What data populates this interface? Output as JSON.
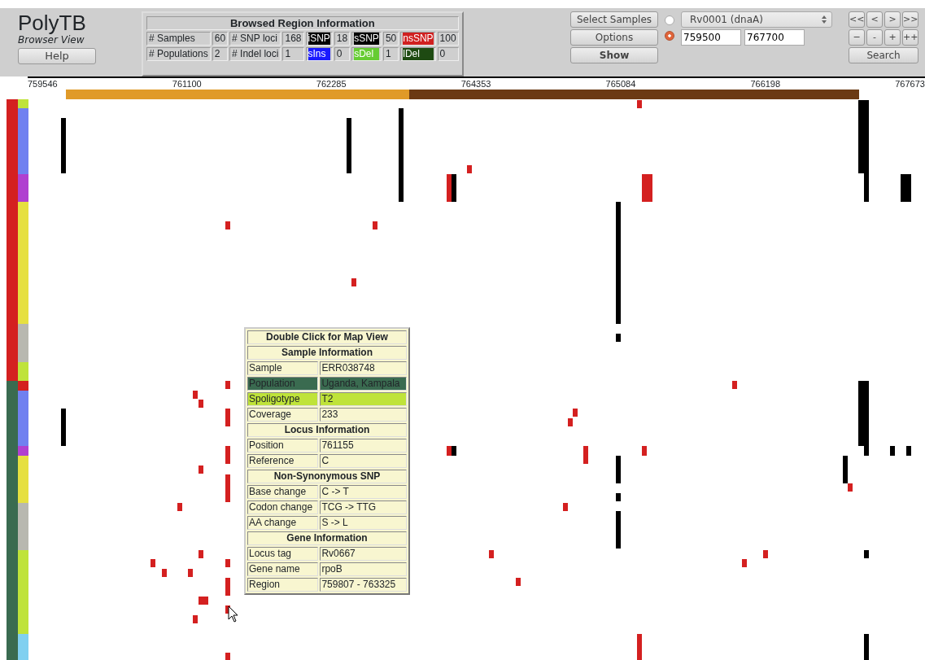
{
  "app": {
    "title": "PolyTB",
    "subtitle": "Browser View",
    "help_button": "Help"
  },
  "region_info": {
    "title": "Browsed Region Information",
    "rows": [
      [
        {
          "kind": "label",
          "text": "# Samples"
        },
        {
          "kind": "value",
          "text": "60"
        },
        {
          "kind": "label",
          "text": "# SNP loci"
        },
        {
          "kind": "value",
          "text": "168"
        },
        {
          "kind": "legend",
          "text": "iSNP",
          "color": "#000000"
        },
        {
          "kind": "value",
          "text": "18"
        },
        {
          "kind": "legend",
          "text": "sSNP",
          "color": "#000000"
        },
        {
          "kind": "value",
          "text": "50"
        },
        {
          "kind": "legend",
          "text": "nsSNP",
          "color": "#d02020"
        },
        {
          "kind": "value",
          "text": "100"
        }
      ],
      [
        {
          "kind": "label",
          "text": "# Populations"
        },
        {
          "kind": "value",
          "text": "2"
        },
        {
          "kind": "label",
          "text": "# Indel loci"
        },
        {
          "kind": "value",
          "text": "1"
        },
        {
          "kind": "legend",
          "text": "sIns",
          "color": "#1a1aff"
        },
        {
          "kind": "value",
          "text": "0"
        },
        {
          "kind": "legend",
          "text": "sDel",
          "color": "#66cc33"
        },
        {
          "kind": "value",
          "text": "1"
        },
        {
          "kind": "legend",
          "text": "lDel",
          "color": "#1e4a12"
        },
        {
          "kind": "value",
          "text": "0"
        }
      ]
    ]
  },
  "controls": {
    "buttons": [
      "Select Samples",
      "Options",
      "Show"
    ],
    "gene_option": {
      "selected": false,
      "value": "Rv0001 (dnaA)"
    },
    "range_option": {
      "selected": true,
      "start": "759500",
      "end": "767700"
    },
    "nav_buttons": [
      "<<",
      "<",
      ">",
      ">>",
      "−",
      "-",
      "+",
      "++"
    ],
    "search_button": "Search"
  },
  "ruler": [
    "759546",
    "761100",
    "762285",
    "764353",
    "765084",
    "766198",
    "767673"
  ],
  "tooltip": {
    "title": "Double Click for Map View",
    "sections": [
      {
        "header": "Sample Information",
        "rows": [
          {
            "label": "Sample",
            "value": "ERR038748"
          },
          {
            "label": "Population",
            "value": "Uganda, Kampala",
            "color": "#3a6b50"
          },
          {
            "label": "Spoligotype",
            "value": "T2",
            "color": "#bfe33a"
          },
          {
            "label": "Coverage",
            "value": "233"
          }
        ]
      },
      {
        "header": "Locus Information",
        "rows": [
          {
            "label": "Position",
            "value": "761155"
          },
          {
            "label": "Reference",
            "value": "C"
          }
        ]
      },
      {
        "header": "Non-Synonymous SNP",
        "rows": [
          {
            "label": "Base change",
            "value": "C -> T"
          },
          {
            "label": "Codon change",
            "value": "TCG -> TTG"
          },
          {
            "label": "AA change",
            "value": "S -> L"
          }
        ]
      },
      {
        "header": "Gene Information",
        "rows": [
          {
            "label": "Locus tag",
            "value": "Rv0667"
          },
          {
            "label": "Gene name",
            "value": "rpoB"
          },
          {
            "label": "Region",
            "value": "759807 - 763325"
          }
        ]
      }
    ]
  }
}
